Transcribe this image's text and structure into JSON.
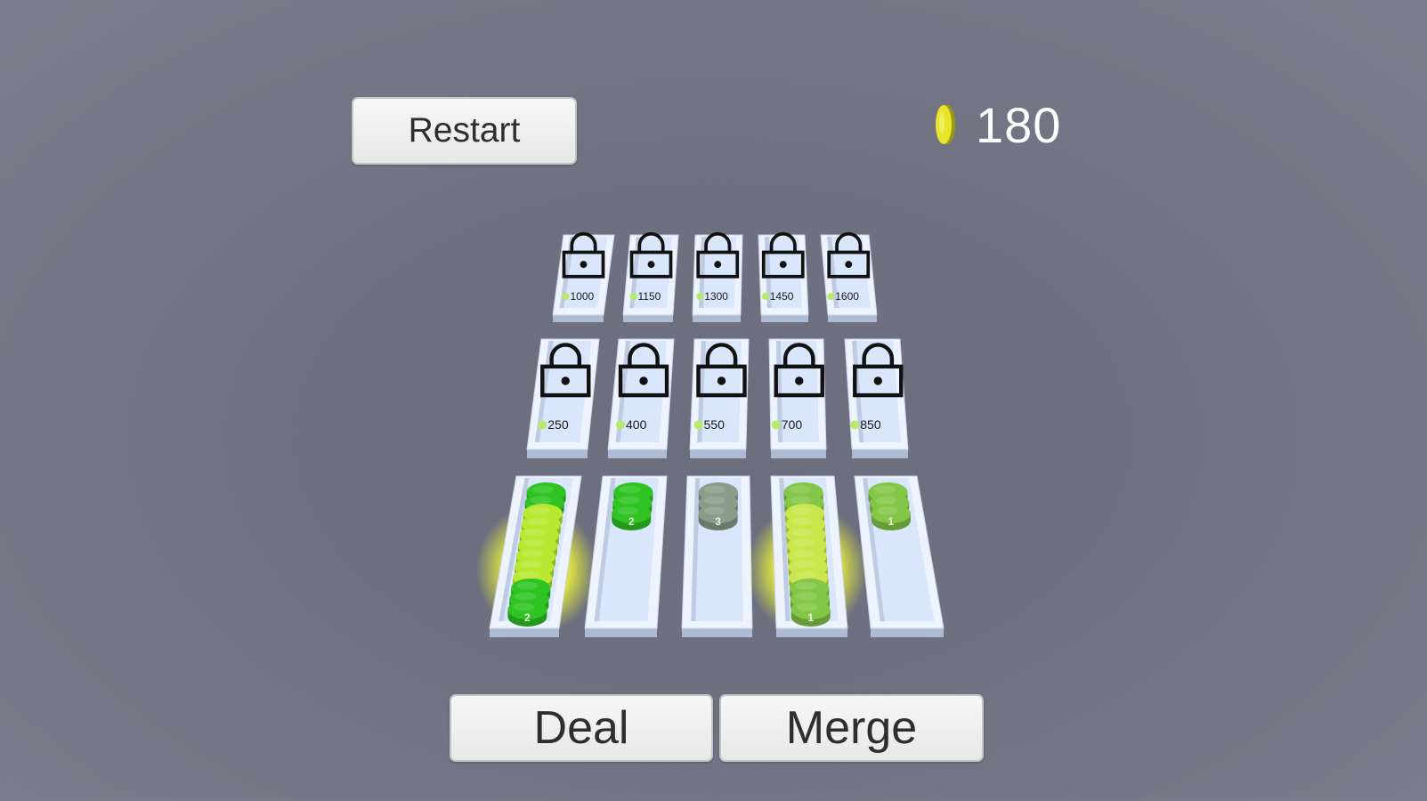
{
  "hud": {
    "restart_label": "Restart",
    "coins": "180",
    "coin_icon": "gold-coin-icon"
  },
  "actions": {
    "deal_label": "Deal",
    "merge_label": "Merge"
  },
  "locked_slots_back_row": [
    {
      "price": "1000"
    },
    {
      "price": "1150"
    },
    {
      "price": "1300"
    },
    {
      "price": "1450"
    },
    {
      "price": "1600"
    }
  ],
  "locked_slots_middle_row": [
    {
      "price": "250"
    },
    {
      "price": "400"
    },
    {
      "price": "550"
    },
    {
      "price": "700"
    },
    {
      "price": "850"
    }
  ],
  "active_slots": [
    {
      "top_number": "2",
      "chip_count": 12,
      "highlighted": true,
      "top_color": "#2fc423"
    },
    {
      "top_number": "2",
      "chip_count": 3,
      "highlighted": false,
      "top_color": "#2fc423"
    },
    {
      "top_number": "3",
      "chip_count": 3,
      "highlighted": false,
      "top_color": "#8b9d8a"
    },
    {
      "top_number": "1",
      "chip_count": 12,
      "highlighted": true,
      "top_color": "#84c748"
    },
    {
      "top_number": "1",
      "chip_count": 3,
      "highlighted": false,
      "top_color": "#84c748"
    }
  ],
  "colors": {
    "slot_face": "#d9e6fb",
    "slot_rim": "#eef4ff",
    "slot_shadow": "#aebbd4",
    "lock_stroke": "#111111",
    "price_dot": "#b8ea6a",
    "glow": "#f4ff3a",
    "coin_gold": "#e7e62a"
  }
}
